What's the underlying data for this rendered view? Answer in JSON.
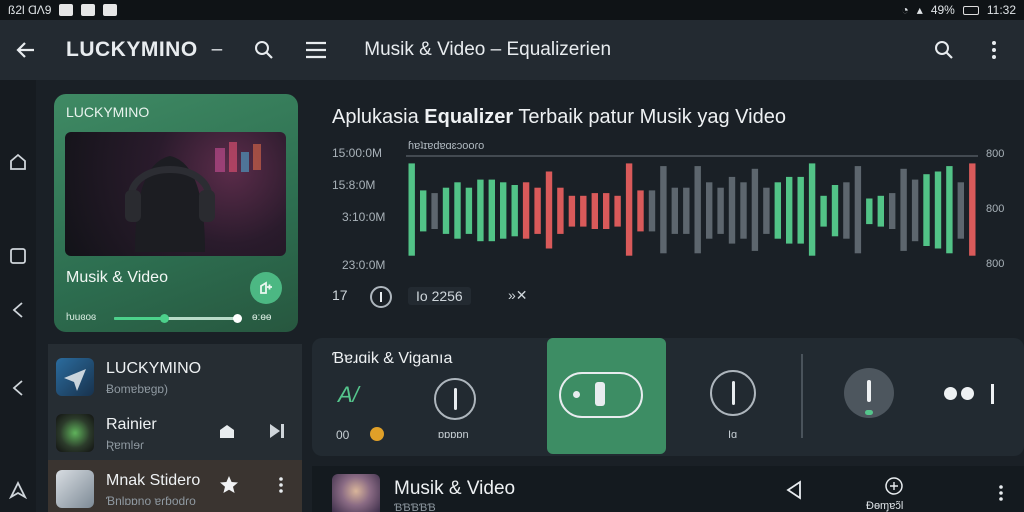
{
  "status": {
    "left_text": "ß2Ɩ ⱭɅ9",
    "battery_text": "49%",
    "time": "11:32"
  },
  "appbar": {
    "brand": "LUCKYMINO",
    "brand_suffix": "–",
    "title": "Musik & Video – Equalizerien"
  },
  "now_playing": {
    "brand": "LUCKYMINO",
    "title": "Musik & Video",
    "elapsed": "ƕuɞoɞ",
    "duration": "ɵ:ɵɵ",
    "progress": 0.4
  },
  "playlist": {
    "items": [
      {
        "title": "LUCKYMINO",
        "subtitle": "Ƀomɐbɐɡɒ)"
      },
      {
        "title": "Rainier",
        "subtitle": "Ʀɐmlɘɾ"
      },
      {
        "title": "Mnak Stidero",
        "subtitle": "Ɓnlɒɒno ɐɾɓodɾo"
      }
    ]
  },
  "equalizer": {
    "heading_plain_1": "Aplukasia ",
    "heading_bold": "Equalizer",
    "heading_plain_2": " Terbaik patur Musik yag Video",
    "y_labels": [
      "15:00:0M",
      "15:8:0M",
      "3:10:0M",
      "23:0:0M"
    ],
    "right_labels": [
      "800",
      "800",
      "800"
    ],
    "legend": "ɦɐʇɪɐdɐɑɛɔooɾo",
    "footer_left": "17",
    "footer_mid": "Io 2256",
    "footer_right": "»✕"
  },
  "chart_data": {
    "type": "bar",
    "colors": {
      "green": "#52c387",
      "red": "#d95a5a",
      "gray": "#5d666e",
      "baseline": "#6c757c"
    },
    "bars": [
      {
        "v": 0.9,
        "c": "green"
      },
      {
        "v": 0.4,
        "c": "green"
      },
      {
        "v": 0.35,
        "c": "gray"
      },
      {
        "v": 0.45,
        "c": "green"
      },
      {
        "v": 0.55,
        "c": "green"
      },
      {
        "v": 0.45,
        "c": "green"
      },
      {
        "v": 0.6,
        "c": "green"
      },
      {
        "v": 0.6,
        "c": "green"
      },
      {
        "v": 0.55,
        "c": "green"
      },
      {
        "v": 0.5,
        "c": "green"
      },
      {
        "v": 0.55,
        "c": "red"
      },
      {
        "v": 0.45,
        "c": "red"
      },
      {
        "v": 0.75,
        "c": "red"
      },
      {
        "v": 0.45,
        "c": "red"
      },
      {
        "v": 0.3,
        "c": "red"
      },
      {
        "v": 0.3,
        "c": "red"
      },
      {
        "v": 0.35,
        "c": "red"
      },
      {
        "v": 0.35,
        "c": "red"
      },
      {
        "v": 0.3,
        "c": "red"
      },
      {
        "v": 0.9,
        "c": "red"
      },
      {
        "v": 0.4,
        "c": "red"
      },
      {
        "v": 0.4,
        "c": "gray"
      },
      {
        "v": 0.85,
        "c": "gray"
      },
      {
        "v": 0.45,
        "c": "gray"
      },
      {
        "v": 0.45,
        "c": "gray"
      },
      {
        "v": 0.85,
        "c": "gray"
      },
      {
        "v": 0.55,
        "c": "gray"
      },
      {
        "v": 0.45,
        "c": "gray"
      },
      {
        "v": 0.65,
        "c": "gray"
      },
      {
        "v": 0.55,
        "c": "gray"
      },
      {
        "v": 0.8,
        "c": "gray"
      },
      {
        "v": 0.45,
        "c": "gray"
      },
      {
        "v": 0.55,
        "c": "green"
      },
      {
        "v": 0.65,
        "c": "green"
      },
      {
        "v": 0.65,
        "c": "green"
      },
      {
        "v": 0.9,
        "c": "green"
      },
      {
        "v": 0.3,
        "c": "green"
      },
      {
        "v": 0.5,
        "c": "green"
      },
      {
        "v": 0.55,
        "c": "gray"
      },
      {
        "v": 0.85,
        "c": "gray"
      },
      {
        "v": 0.25,
        "c": "green"
      },
      {
        "v": 0.3,
        "c": "green"
      },
      {
        "v": 0.35,
        "c": "gray"
      },
      {
        "v": 0.8,
        "c": "gray"
      },
      {
        "v": 0.6,
        "c": "gray"
      },
      {
        "v": 0.7,
        "c": "green"
      },
      {
        "v": 0.75,
        "c": "green"
      },
      {
        "v": 0.85,
        "c": "green"
      },
      {
        "v": 0.55,
        "c": "gray"
      },
      {
        "v": 0.9,
        "c": "red"
      }
    ]
  },
  "controls": {
    "title": "Ɓɐɹɑik & Viganıa",
    "knob1_label": "ɒɒɒɒn",
    "knob2_label": "Iɑ",
    "left_value": "00"
  },
  "bottom": {
    "title": "Musik & Video",
    "subtitle": "ƁƁƁƁƁ",
    "action_label": "Ɖɵɱɐɔ̃l"
  }
}
